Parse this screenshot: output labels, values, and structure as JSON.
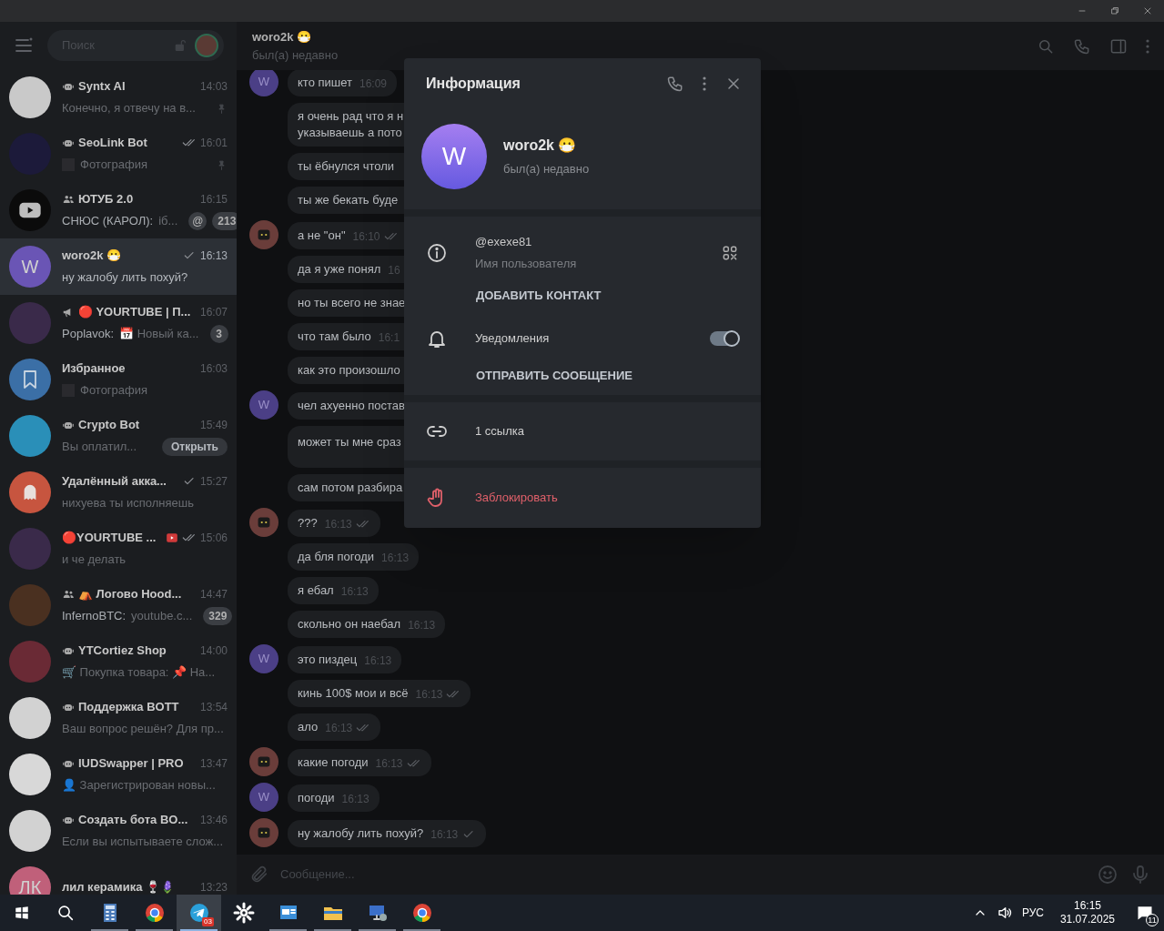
{
  "sidebar": {
    "search": {
      "placeholder": "Поиск"
    },
    "chats": [
      {
        "name": "Syntx AI",
        "kind": "bot",
        "time": "14:03",
        "preview": "Конечно, я отвечу на в...",
        "pinned": true,
        "selected": false,
        "avatar": {
          "kind": "photo",
          "color": "#c9c9c9"
        }
      },
      {
        "name": "SeoLink Bot",
        "kind": "bot",
        "time": "16:01",
        "sent": true,
        "read": true,
        "thumb": true,
        "preview": "Фотография",
        "pinned": true,
        "selected": false,
        "avatar": {
          "kind": "photo",
          "color": "#1c1a3a"
        }
      },
      {
        "name": "ЮТУБ 2.0",
        "kind": "group",
        "time": "16:15",
        "sender": "СНЮС (КАРОЛ):",
        "preview": "іб...",
        "mention": "@",
        "badge": "213",
        "selected": false,
        "avatar": {
          "kind": "play",
          "color": "#0b0b0b"
        }
      },
      {
        "name": "woro2k 😷",
        "kind": "user",
        "time": "16:13",
        "sent": true,
        "read": false,
        "preview": "ну жалобу лить похуй?",
        "selected": true,
        "avatar": {
          "kind": "letter",
          "text": "W",
          "color": "#6a55b5"
        }
      },
      {
        "name": "🔴 YOURTUBE | П...",
        "kind": "channel",
        "time": "16:07",
        "sender": "Poplavok:",
        "preview": "📅 Новый ка...",
        "badge": "3",
        "selected": false,
        "avatar": {
          "kind": "photo",
          "color": "#3a2a4a"
        }
      },
      {
        "name": "Избранное",
        "kind": "user",
        "time": "16:03",
        "thumb": true,
        "preview": "Фотография",
        "selected": false,
        "avatar": {
          "kind": "bookmark",
          "color": "#3b6fa6"
        }
      },
      {
        "name": "Crypto Bot",
        "kind": "bot",
        "time": "15:49",
        "preview": "Вы оплатил...",
        "action": "Открыть",
        "selected": false,
        "avatar": {
          "kind": "photo",
          "color": "#2a8fb8"
        }
      },
      {
        "name": "Удалённый акка...",
        "kind": "user",
        "time": "15:27",
        "sent": true,
        "read": false,
        "preview": "нихуева ты исполняешь",
        "selected": false,
        "avatar": {
          "kind": "ghost",
          "color": "#c7553f"
        }
      },
      {
        "name": "🔴YOURTUBE ...",
        "kind": "user",
        "time": "15:06",
        "sent": true,
        "read": true,
        "status": true,
        "preview": "и че делать",
        "selected": false,
        "avatar": {
          "kind": "photo",
          "color": "#3a2a4a"
        }
      },
      {
        "name": "⛺ Логово Hood...",
        "kind": "group",
        "time": "14:47",
        "sender": "InfernoBTC:",
        "preview": "youtube.c...",
        "badge": "329",
        "selected": false,
        "avatar": {
          "kind": "photo",
          "color": "#4a3020"
        }
      },
      {
        "name": "YTCortiez Shop",
        "kind": "bot",
        "time": "14:00",
        "preview": "🛒 Покупка товара: 📌 На...",
        "selected": false,
        "avatar": {
          "kind": "photo",
          "color": "#6a2a35"
        }
      },
      {
        "name": "Поддержка BOTT",
        "kind": "bot",
        "time": "13:54",
        "preview": "Ваш вопрос решён? Для пр...",
        "selected": false,
        "avatar": {
          "kind": "photo",
          "color": "#d2d2d2"
        }
      },
      {
        "name": "IUDSwapper | PRO",
        "kind": "bot",
        "time": "13:47",
        "preview": "👤 Зарегистрирован новы...",
        "selected": false,
        "avatar": {
          "kind": "photo",
          "color": "#d8d8d8"
        }
      },
      {
        "name": "Создать бота BO...",
        "kind": "bot",
        "time": "13:46",
        "preview": "Если вы испытываете слож...",
        "selected": false,
        "avatar": {
          "kind": "photo",
          "color": "#d2d2d2"
        }
      },
      {
        "name": "лил керамика 🍷🪻",
        "kind": "user",
        "time": "13:23",
        "selected": false,
        "avatar": {
          "kind": "letter",
          "text": "ЛК",
          "color": "#c0607a"
        }
      }
    ]
  },
  "chat": {
    "title": "woro2k 😷",
    "status": "был(а) недавно",
    "messages": [
      {
        "lines": [
          "кто пишет"
        ],
        "time": "16:09",
        "avatar": {
          "kind": "letter",
          "text": "W"
        }
      },
      {
        "lines": [
          "я очень рад что я н",
          "указываешь а пото"
        ],
        "clipped": true
      },
      {
        "lines": [
          "ты ёбнулся чтоли"
        ],
        "clipped": true
      },
      {
        "lines": [
          "ты же бекать буде"
        ],
        "clipped": true
      },
      {
        "lines": [
          "а не \"он\""
        ],
        "time": "16:10",
        "sent": true,
        "read": true,
        "avatar": {
          "kind": "robot"
        },
        "clipped": true
      },
      {
        "lines": [
          "да я уже понял"
        ],
        "time": "16",
        "clipped": true
      },
      {
        "lines": [
          "но ты всего не знае"
        ],
        "clipped": true
      },
      {
        "lines": [
          "что там было"
        ],
        "time": "16:1",
        "clipped": true
      },
      {
        "lines": [
          "как это произошло"
        ],
        "clipped": true
      },
      {
        "lines": [
          "чел ахуенно постав"
        ],
        "avatar": {
          "kind": "letter",
          "text": "W"
        },
        "clipped": true
      },
      {
        "lines": [
          "может ты мне сраз"
        ],
        "tall": true,
        "clipped": true
      },
      {
        "lines": [
          "сам потом разбира"
        ],
        "clipped": true
      },
      {
        "lines": [
          "???"
        ],
        "time": "16:13",
        "sent": true,
        "read": true,
        "avatar": {
          "kind": "robot"
        }
      },
      {
        "lines": [
          "да бля погоди"
        ],
        "time": "16:13"
      },
      {
        "lines": [
          "я ебал"
        ],
        "time": "16:13"
      },
      {
        "lines": [
          "скольно он наебал"
        ],
        "time": "16:13"
      },
      {
        "lines": [
          "это пиздец"
        ],
        "time": "16:13",
        "avatar": {
          "kind": "letter",
          "text": "W"
        }
      },
      {
        "lines": [
          "кинь 100$ мои и всё"
        ],
        "time": "16:13",
        "sent": true,
        "read": true
      },
      {
        "lines": [
          "ало"
        ],
        "time": "16:13",
        "sent": true,
        "read": true
      },
      {
        "lines": [
          "какие погоди"
        ],
        "time": "16:13",
        "sent": true,
        "read": true,
        "avatar": {
          "kind": "robot"
        }
      },
      {
        "lines": [
          "погоди"
        ],
        "time": "16:13",
        "avatar": {
          "kind": "letter",
          "text": "W"
        }
      },
      {
        "lines": [
          "ну жалобу лить похуй?"
        ],
        "time": "16:13",
        "sent": true,
        "read": false,
        "avatar": {
          "kind": "robot"
        }
      }
    ],
    "composer": {
      "placeholder": "Сообщение..."
    }
  },
  "info": {
    "title": "Информация",
    "avatar": "W",
    "name": "woro2k 😷",
    "status": "был(а) недавно",
    "username": "@exexe81",
    "username_label": "Имя пользователя",
    "add_contact": "ДОБАВИТЬ КОНТАКТ",
    "notifications": {
      "label": "Уведомления",
      "on": true
    },
    "send_message": "ОТПРАВИТЬ СООБЩЕНИЕ",
    "links": "1 ссылка",
    "block": "Заблокировать"
  },
  "taskbar": {
    "apps": [
      {
        "kind": "calculator",
        "active": false,
        "open": true
      },
      {
        "kind": "chrome",
        "active": false,
        "open": true
      },
      {
        "kind": "telegram",
        "active": true,
        "open": true,
        "badge": "03"
      },
      {
        "kind": "settings",
        "active": false,
        "open": false
      },
      {
        "kind": "window",
        "active": false,
        "open": true
      },
      {
        "kind": "folder",
        "active": false,
        "open": true
      },
      {
        "kind": "remote",
        "active": false,
        "open": true
      },
      {
        "kind": "chrome",
        "active": false,
        "open": true
      }
    ],
    "language": "РУС",
    "time": "16:15",
    "date": "31.07.2025",
    "notifications": "11"
  }
}
